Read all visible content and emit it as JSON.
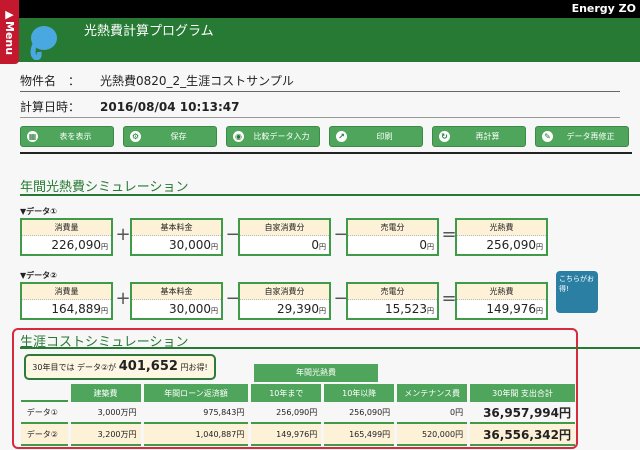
{
  "topbar": {
    "brand": "Energy ZO"
  },
  "menu": {
    "label": "▶Menu"
  },
  "header": {
    "title": "光熱費計算プログラム"
  },
  "info": {
    "name_label": "物件名　：",
    "name_value": "光熱費0820_2_生涯コストサンプル",
    "date_label": "計算日時：",
    "date_value": "2016/08/04 10:13:47"
  },
  "toolbar": [
    {
      "label": "表を表示",
      "icon": "grid-icon"
    },
    {
      "label": "保存",
      "icon": "gear-icon"
    },
    {
      "label": "比較データ入力",
      "icon": "eye-icon"
    },
    {
      "label": "印刷",
      "icon": "export-icon"
    },
    {
      "label": "再計算",
      "icon": "refresh-icon"
    },
    {
      "label": "データ再修正",
      "icon": "pencil-icon"
    }
  ],
  "annual": {
    "title": "年間光熱費シミュレーション",
    "ops": [
      "+",
      "−",
      "−",
      "="
    ],
    "unit": "円",
    "datasets": [
      {
        "label": "▼データ①",
        "items": [
          {
            "h": "消費量",
            "v": "226,090"
          },
          {
            "h": "基本料金",
            "v": "30,000"
          },
          {
            "h": "自家消費分",
            "v": "0"
          },
          {
            "h": "売電分",
            "v": "0"
          },
          {
            "h": "光熱費",
            "v": "256,090"
          }
        ]
      },
      {
        "label": "▼データ②",
        "items": [
          {
            "h": "消費量",
            "v": "164,889"
          },
          {
            "h": "基本料金",
            "v": "30,000"
          },
          {
            "h": "自家消費分",
            "v": "29,390"
          },
          {
            "h": "売電分",
            "v": "15,523"
          },
          {
            "h": "光熱費",
            "v": "149,976"
          }
        ]
      }
    ],
    "balloon": "こちらがお得!"
  },
  "lifecycle": {
    "title": "生涯コストシミュレーション",
    "savings_prefix": "30年目では データ②が",
    "savings_value": "401,652",
    "savings_suffix": "円お得!",
    "group_header": "年間光熱費",
    "columns": [
      "",
      "建築費",
      "年間ローン返済額",
      "10年まで",
      "10年以降",
      "メンテナンス費",
      "30年間 支出合計"
    ],
    "rows": [
      [
        "データ①",
        "3,000万円",
        "975,843円",
        "256,090円",
        "256,090円",
        "0円",
        "36,957,994円"
      ],
      [
        "データ②",
        "3,200万円",
        "1,040,887円",
        "149,976円",
        "165,499円",
        "520,000円",
        "36,556,342円"
      ]
    ]
  },
  "colors": {
    "header": "#267a33",
    "button": "#4ea55b",
    "menu": "#c4182e",
    "highlight": "#d62b3c"
  }
}
